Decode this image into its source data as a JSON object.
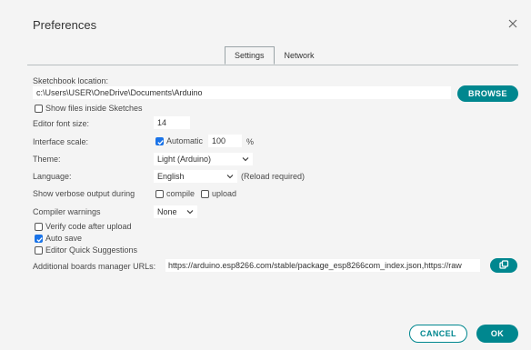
{
  "dialog": {
    "title": "Preferences"
  },
  "tabs": [
    {
      "label": "Settings",
      "active": true
    },
    {
      "label": "Network",
      "active": false
    }
  ],
  "sketchbook": {
    "label": "Sketchbook location:",
    "path": "c:\\Users\\USER\\OneDrive\\Documents\\Arduino",
    "browse_label": "BROWSE",
    "show_files_label": "Show files inside Sketches",
    "show_files_checked": false
  },
  "editor_font": {
    "label": "Editor font size:",
    "value": "14"
  },
  "interface_scale": {
    "label": "Interface scale:",
    "automatic_label": "Automatic",
    "automatic_checked": true,
    "value": "100",
    "unit": "%"
  },
  "theme": {
    "label": "Theme:",
    "value": "Light (Arduino)"
  },
  "language": {
    "label": "Language:",
    "value": "English",
    "note": "(Reload required)"
  },
  "verbose": {
    "label": "Show verbose output during",
    "compile_label": "compile",
    "upload_label": "upload",
    "compile_checked": false,
    "upload_checked": false
  },
  "warnings": {
    "label": "Compiler warnings",
    "value": "None"
  },
  "checks": {
    "verify_label": "Verify code after upload",
    "verify_checked": false,
    "autosave_label": "Auto save",
    "autosave_checked": true,
    "quick_label": "Editor Quick Suggestions",
    "quick_checked": false
  },
  "boards": {
    "label": "Additional boards manager URLs:",
    "value": "https://arduino.esp8266.com/stable/package_esp8266com_index.json,https://raw"
  },
  "footer": {
    "cancel_label": "CANCEL",
    "ok_label": "OK"
  },
  "colors": {
    "accent": "#00878f",
    "checkbox": "#1a73e8",
    "background": "#f4f4f4"
  },
  "icons": {
    "close": "close-icon",
    "open_window": "open-window-icon",
    "chevron": "chevron-down-icon",
    "check": "check-icon"
  }
}
